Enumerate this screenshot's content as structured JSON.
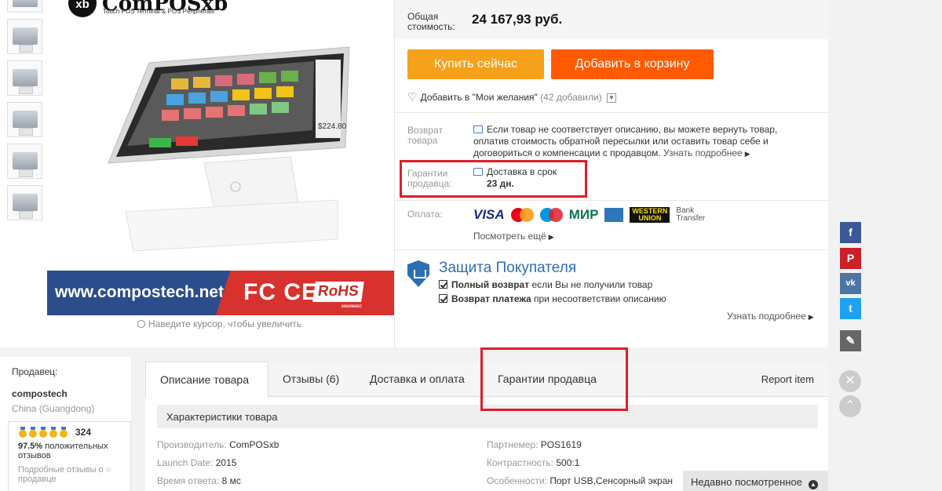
{
  "product": {
    "logo_badge": "xb",
    "logo_name": "ComPOSxb",
    "logo_tagline": "Touch POS Terminal & POS Peripherals",
    "pos_screen_price": "$224.80",
    "banner_site": "www.compostech.net",
    "banner_marks": "FC CE",
    "banner_rohs": "RoHS",
    "banner_rohs_code": "2002/95/EC",
    "zoom_hint": "Наведите курсор, чтобы увеличить",
    "thumbnail_count": 6
  },
  "price": {
    "label_line1": "Общая",
    "label_line2": "стоимость:",
    "value": "24 167,93 руб."
  },
  "actions": {
    "buy_now": "Купить сейчас",
    "add_to_cart": "Добавить в корзину",
    "wishlist": "Добавить в \"Мои желания\"",
    "wishlist_count": "(42 добавили)"
  },
  "returns": {
    "label_line1": "Возврат",
    "label_line2": "товара",
    "text_line1": "Если товар не соответствует описанию, вы можете вернуть товар,",
    "text_line2": "оплатив стоимость обратной пересылки или оставить товар себе и",
    "text_line3": "договориться о компенсации с продавцом.",
    "more": "Узнать подробнее"
  },
  "guarantee": {
    "label_line1": "Гарантии",
    "label_line2": "продавца:",
    "delivery": "Доставка в срок",
    "days": "23 дн."
  },
  "payment": {
    "label": "Оплата:",
    "methods": [
      "VISA",
      "MasterCard",
      "Maestro",
      "МИР",
      "AmEx",
      "WESTERN UNION",
      "Bank Transfer"
    ],
    "visa": "VISA",
    "mir": "МИР",
    "wu_line1": "WESTERN",
    "wu_line2": "UNION",
    "bank_line1": "Bank",
    "bank_line2": "Transfer",
    "see_more": "Посмотреть ещё"
  },
  "protection": {
    "title": "Защита Покупателя",
    "item1_bold": "Полный возврат",
    "item1_rest": " если Вы не получили товар",
    "item2_bold": "Возврат платежа",
    "item2_rest": " при несоответствии описанию",
    "more": "Узнать подробнее"
  },
  "seller": {
    "label": "Продавец:",
    "name": "compostech",
    "location": "China (Guangdong)",
    "feedback_count": "324",
    "positive_pct": "97.5%",
    "positive_text_1": "положительных",
    "positive_text_2": "отзывов",
    "detail_link_1": "Подробные отзывы о",
    "detail_link_2": "продавце"
  },
  "tabs": {
    "description": "Описание товара",
    "reviews": "Отзывы (6)",
    "shipping": "Доставка и оплата",
    "guarantees": "Гарантии продавца",
    "report": "Report item"
  },
  "specs": {
    "header": "Характеристики товара",
    "left": [
      {
        "k": "Производитель:",
        "v": "ComPOSxb"
      },
      {
        "k": "Launch Date:",
        "v": "2015"
      },
      {
        "k": "Время ответа:",
        "v": "8 мс"
      }
    ],
    "right": [
      {
        "k": "Партнeмер:",
        "v": "POS1619"
      },
      {
        "k": "Контрастность:",
        "v": "500:1"
      },
      {
        "k": "Особенности:",
        "v": "Порт USB,Сенсорный экран"
      }
    ]
  },
  "recently_viewed": "Недавно посмотренное",
  "social": [
    "f",
    "P",
    "vk",
    "t"
  ],
  "colors": {
    "buy": "#f5a11a",
    "cart": "#ff5a00",
    "highlight": "#e01d2a",
    "protection": "#2e6eb3",
    "facebook": "#3b5998",
    "pinterest": "#cb2027",
    "vk": "#4c75a3",
    "twitter": "#1da1f2"
  }
}
